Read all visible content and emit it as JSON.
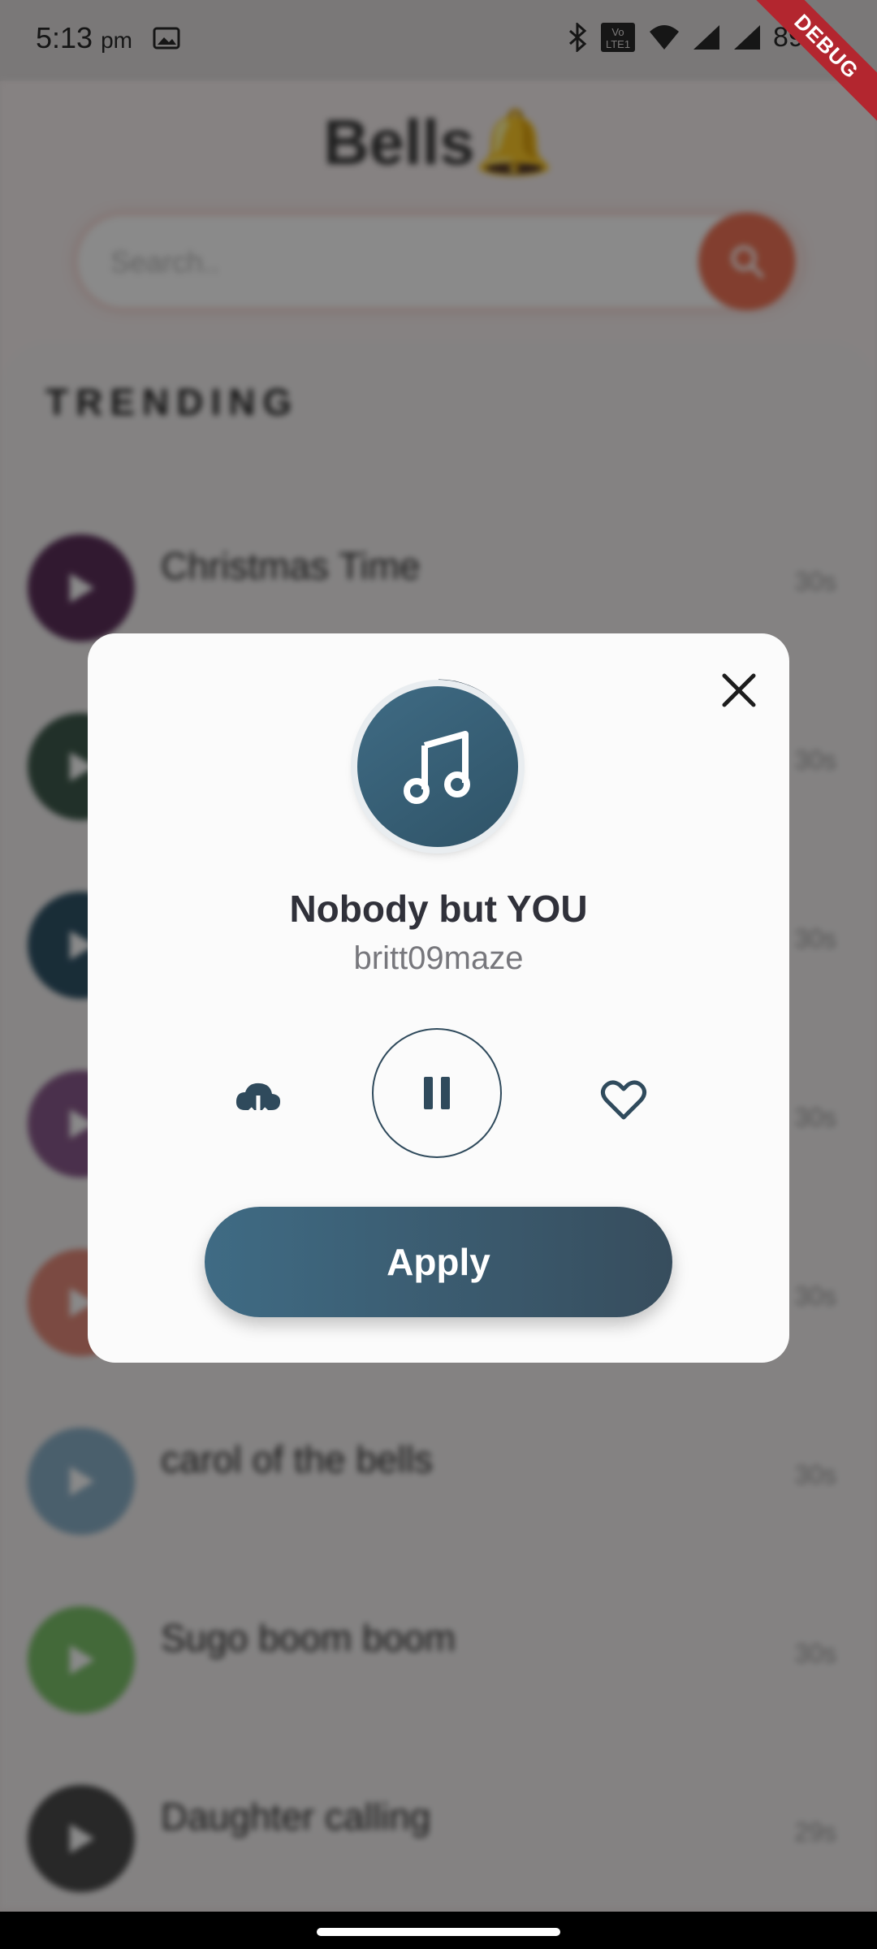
{
  "status_bar": {
    "time": "5:13",
    "ampm": "pm",
    "battery": "89%",
    "debug_label": "DEBUG"
  },
  "app": {
    "title": "Bells",
    "title_emoji": "🔔",
    "search": {
      "placeholder": "Search.."
    },
    "section_label": "TRENDING",
    "tracks": [
      {
        "title": "Christmas Time",
        "subtitle": "",
        "duration": "30s",
        "color": "#5c2f5a"
      },
      {
        "title": "",
        "subtitle": "",
        "duration": "30s",
        "color": "#3e5a4c"
      },
      {
        "title": "",
        "subtitle": "",
        "duration": "30s",
        "color": "#2f5367"
      },
      {
        "title": "",
        "subtitle": "",
        "duration": "30s",
        "color": "#8a5a8c"
      },
      {
        "title": "",
        "subtitle": "",
        "duration": "30s",
        "color": "#e48a7a"
      },
      {
        "title": "carol of the bells",
        "subtitle": "",
        "duration": "30s",
        "color": "#8ab0c8"
      },
      {
        "title": "Sugo boom boom",
        "subtitle": "",
        "duration": "30s",
        "color": "#7cc26a"
      },
      {
        "title": "Daughter calling",
        "subtitle": "",
        "duration": "29s",
        "color": "#4a4a4a"
      }
    ]
  },
  "modal": {
    "song_title": "Nobody but YOU",
    "artist": "britt09maze",
    "apply_label": "Apply",
    "accent_color": "#3f6b84",
    "playback_progress": 0.12,
    "icons": {
      "close": "close-icon",
      "note": "music-note-icon",
      "download": "cloud-download-icon",
      "pause": "pause-icon",
      "favorite": "heart-outline-icon"
    }
  }
}
